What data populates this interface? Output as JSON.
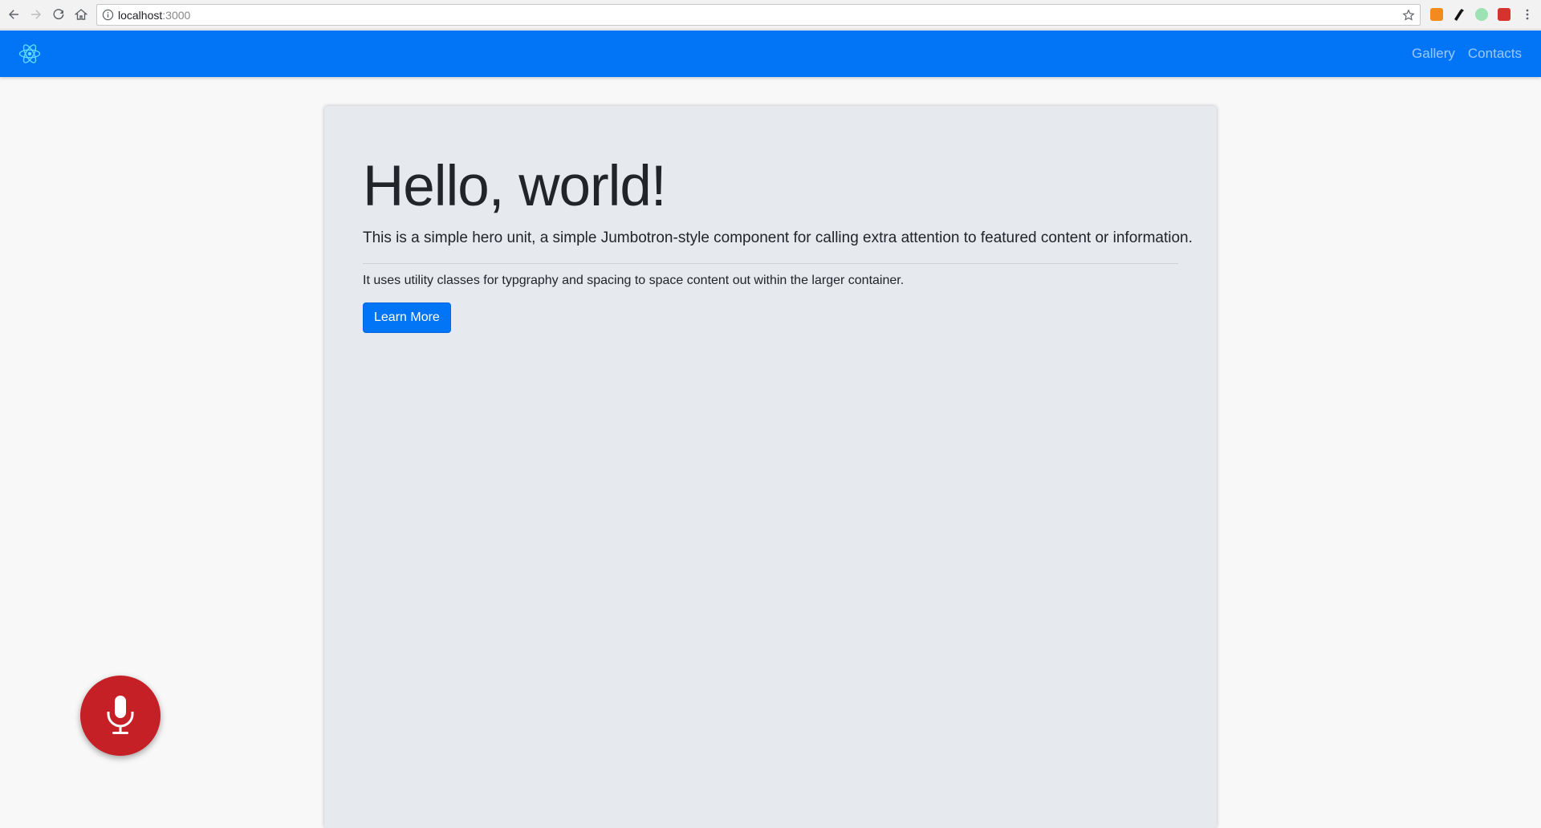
{
  "browser": {
    "url_host": "localhost",
    "url_port": ":3000"
  },
  "navbar": {
    "brand_icon": "react-logo-icon",
    "links": [
      {
        "label": "Gallery"
      },
      {
        "label": "Contacts"
      }
    ]
  },
  "hero": {
    "title": "Hello, world!",
    "lead": "This is a simple hero unit, a simple Jumbotron-style component for calling extra attention to featured content or information.",
    "body": "It uses utility classes for typgraphy and spacing to space content out within the larger container.",
    "button_label": "Learn More"
  },
  "mic": {
    "icon": "microphone-icon",
    "color": "#c52026"
  },
  "colors": {
    "brand": "#0275f7",
    "jumbotron_bg": "#e6e9ee"
  }
}
